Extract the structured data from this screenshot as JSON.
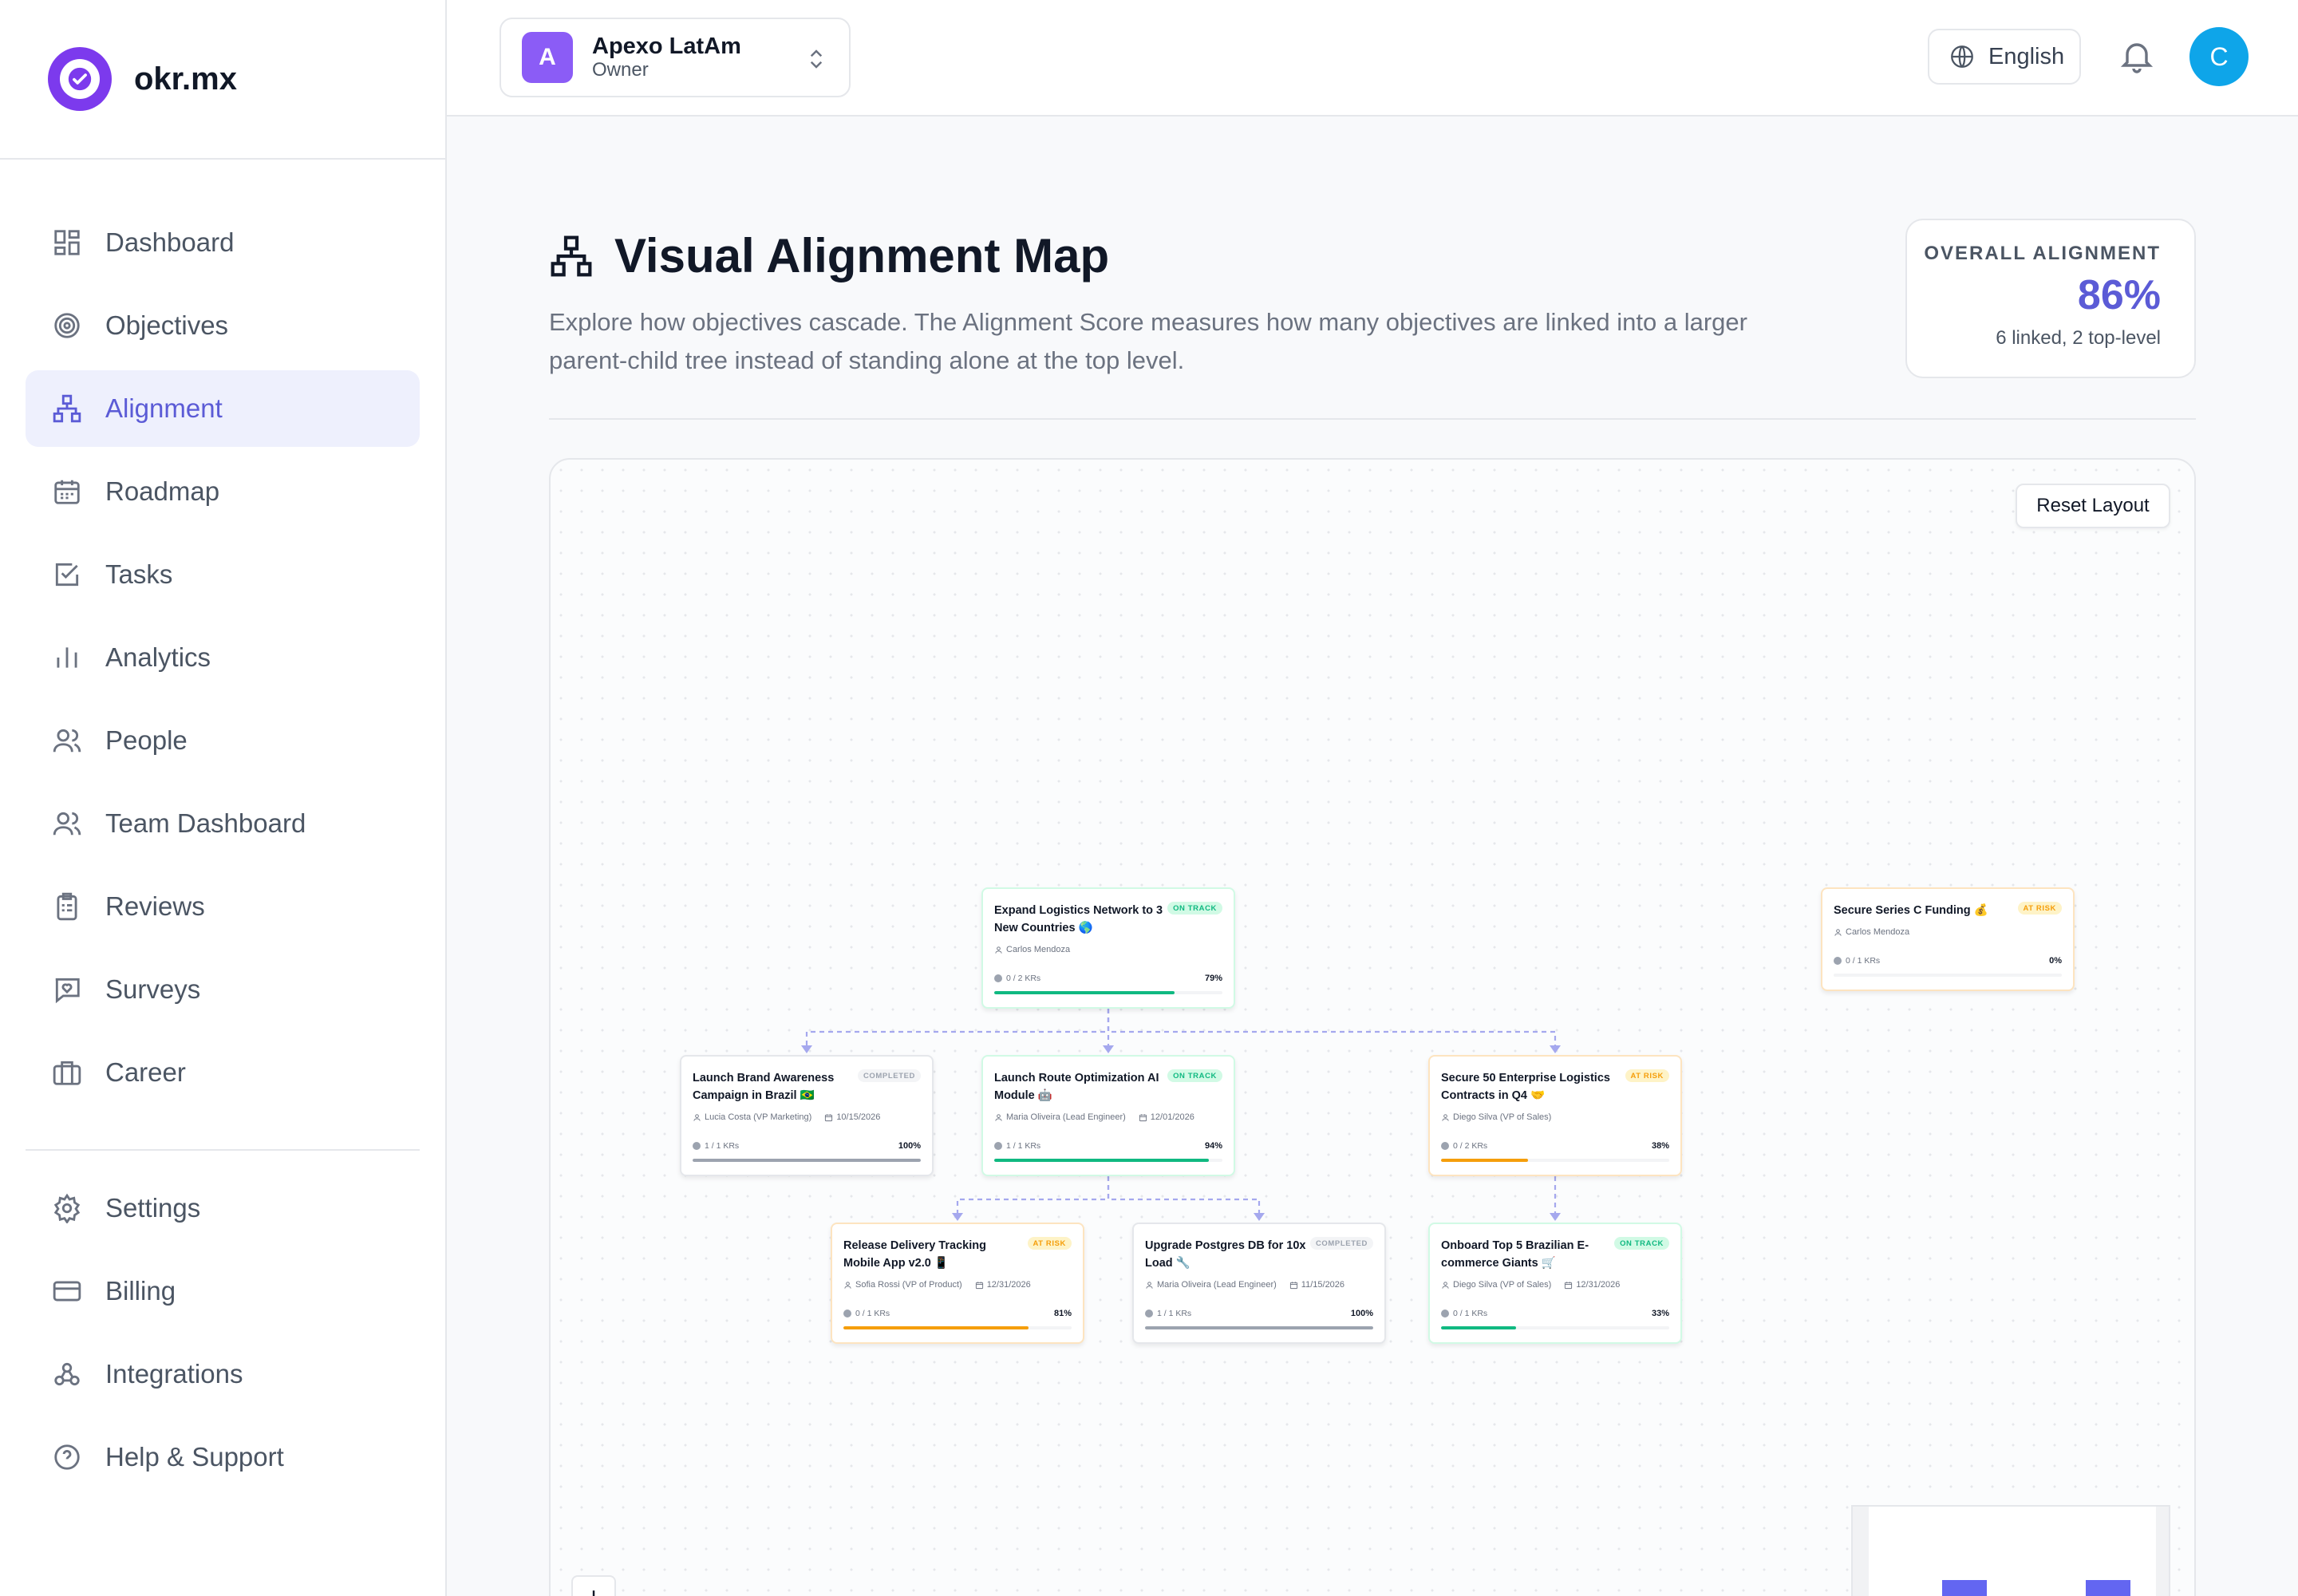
{
  "brand": {
    "name": "okr.mx"
  },
  "nav": {
    "main": [
      {
        "label": "Dashboard",
        "icon": "dashboard-icon",
        "active": false
      },
      {
        "label": "Objectives",
        "icon": "target-icon",
        "active": false
      },
      {
        "label": "Alignment",
        "icon": "hierarchy-icon",
        "active": true
      },
      {
        "label": "Roadmap",
        "icon": "calendar-icon",
        "active": false
      },
      {
        "label": "Tasks",
        "icon": "checkbox-icon",
        "active": false
      },
      {
        "label": "Analytics",
        "icon": "bar-chart-icon",
        "active": false
      },
      {
        "label": "People",
        "icon": "people-icon",
        "active": false
      },
      {
        "label": "Team Dashboard",
        "icon": "team-icon",
        "active": false
      },
      {
        "label": "Reviews",
        "icon": "clipboard-icon",
        "active": false
      },
      {
        "label": "Surveys",
        "icon": "survey-icon",
        "active": false
      },
      {
        "label": "Career",
        "icon": "briefcase-icon",
        "active": false
      }
    ],
    "bottom": [
      {
        "label": "Settings",
        "icon": "gear-icon"
      },
      {
        "label": "Billing",
        "icon": "credit-card-icon"
      },
      {
        "label": "Integrations",
        "icon": "webhook-icon"
      },
      {
        "label": "Help & Support",
        "icon": "help-icon"
      }
    ]
  },
  "workspace": {
    "initial": "A",
    "name": "Apexo LatAm",
    "role": "Owner"
  },
  "topbar": {
    "language": "English",
    "user_initial": "C"
  },
  "header": {
    "title": "Visual Alignment Map",
    "description": "Explore how objectives cascade. The Alignment Score measures how many objectives are linked into a larger parent-child tree instead of standing alone at the top level."
  },
  "score": {
    "label": "OVERALL ALIGNMENT",
    "value": "86%",
    "sub": "6 linked, 2 top-level"
  },
  "map": {
    "reset_label": "Reset Layout",
    "zoom_in": "+",
    "nodes": [
      {
        "id": "n1",
        "title": "Expand Logistics Network to 3 New Countries 🌎",
        "status": "ON TRACK",
        "owner": "Carlos Mendoza",
        "date": "",
        "krs": "0 / 2 KRs",
        "pct": "79%",
        "progress": 0.79,
        "color": "#10b981"
      },
      {
        "id": "n2",
        "title": "Secure Series C Funding 💰",
        "status": "AT RISK",
        "owner": "Carlos Mendoza",
        "date": "",
        "krs": "0 / 1 KRs",
        "pct": "0%",
        "progress": 0,
        "color": "#f59e0b"
      },
      {
        "id": "n3",
        "title": "Launch Brand Awareness Campaign in Brazil 🇧🇷",
        "status": "COMPLETED",
        "owner": "Lucia Costa (VP Marketing)",
        "date": "10/15/2026",
        "krs": "1 / 1 KRs",
        "pct": "100%",
        "progress": 1.0,
        "color": "#9ca3af"
      },
      {
        "id": "n4",
        "title": "Launch Route Optimization AI Module 🤖",
        "status": "ON TRACK",
        "owner": "Maria Oliveira (Lead Engineer)",
        "date": "12/01/2026",
        "krs": "1 / 1 KRs",
        "pct": "94%",
        "progress": 0.94,
        "color": "#10b981"
      },
      {
        "id": "n5",
        "title": "Secure 50 Enterprise Logistics Contracts in Q4 🤝",
        "status": "AT RISK",
        "owner": "Diego Silva (VP of Sales)",
        "date": "",
        "krs": "0 / 2 KRs",
        "pct": "38%",
        "progress": 0.38,
        "color": "#f59e0b"
      },
      {
        "id": "n6",
        "title": "Release Delivery Tracking Mobile App v2.0 📱",
        "status": "AT RISK",
        "owner": "Sofia Rossi (VP of Product)",
        "date": "12/31/2026",
        "krs": "0 / 1 KRs",
        "pct": "81%",
        "progress": 0.81,
        "color": "#f59e0b"
      },
      {
        "id": "n7",
        "title": "Upgrade Postgres DB for 10x Load 🔧",
        "status": "COMPLETED",
        "owner": "Maria Oliveira (Lead Engineer)",
        "date": "11/15/2026",
        "krs": "1 / 1 KRs",
        "pct": "100%",
        "progress": 1.0,
        "color": "#9ca3af"
      },
      {
        "id": "n8",
        "title": "Onboard Top 5 Brazilian E-commerce Giants 🛒",
        "status": "ON TRACK",
        "owner": "Diego Silva (VP of Sales)",
        "date": "12/31/2026",
        "krs": "0 / 1 KRs",
        "pct": "33%",
        "progress": 0.33,
        "color": "#10b981"
      }
    ],
    "edges": [
      [
        "n1",
        "n3"
      ],
      [
        "n1",
        "n4"
      ],
      [
        "n1",
        "n5"
      ],
      [
        "n4",
        "n6"
      ],
      [
        "n4",
        "n7"
      ],
      [
        "n5",
        "n8"
      ]
    ]
  }
}
